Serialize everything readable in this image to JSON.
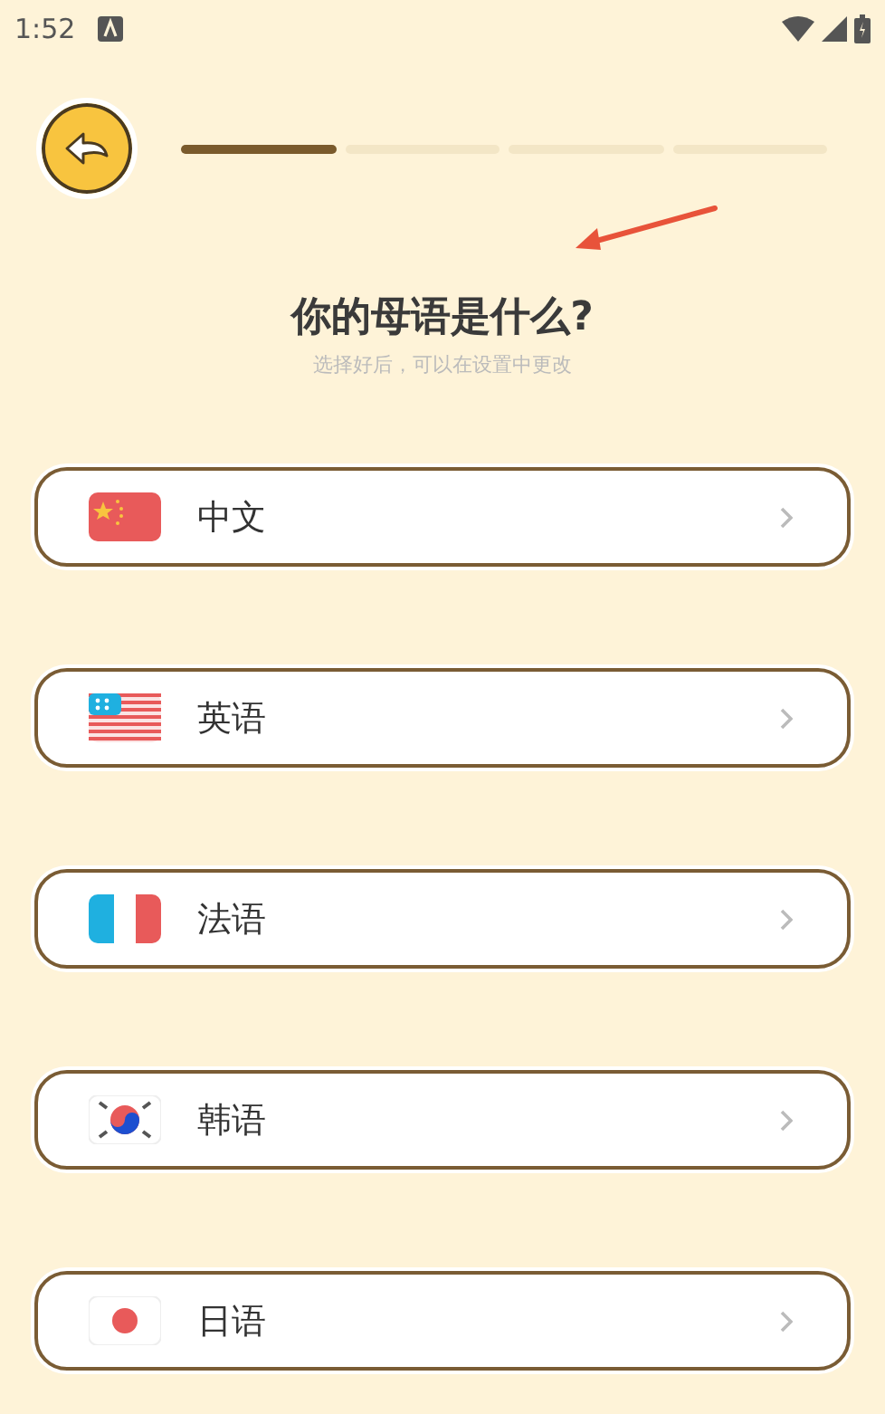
{
  "status_bar": {
    "time": "1:52"
  },
  "progress": {
    "steps": [
      {
        "done": true
      },
      {
        "done": false
      },
      {
        "done": false
      },
      {
        "done": false
      }
    ]
  },
  "title": "你的母语是什么?",
  "subtitle": "选择好后，可以在设置中更改",
  "languages": [
    {
      "label": "中文",
      "kind": "cn"
    },
    {
      "label": "英语",
      "kind": "us"
    },
    {
      "label": "法语",
      "kind": "fr"
    },
    {
      "label": "韩语",
      "kind": "kr"
    },
    {
      "label": "日语",
      "kind": "jp"
    }
  ]
}
